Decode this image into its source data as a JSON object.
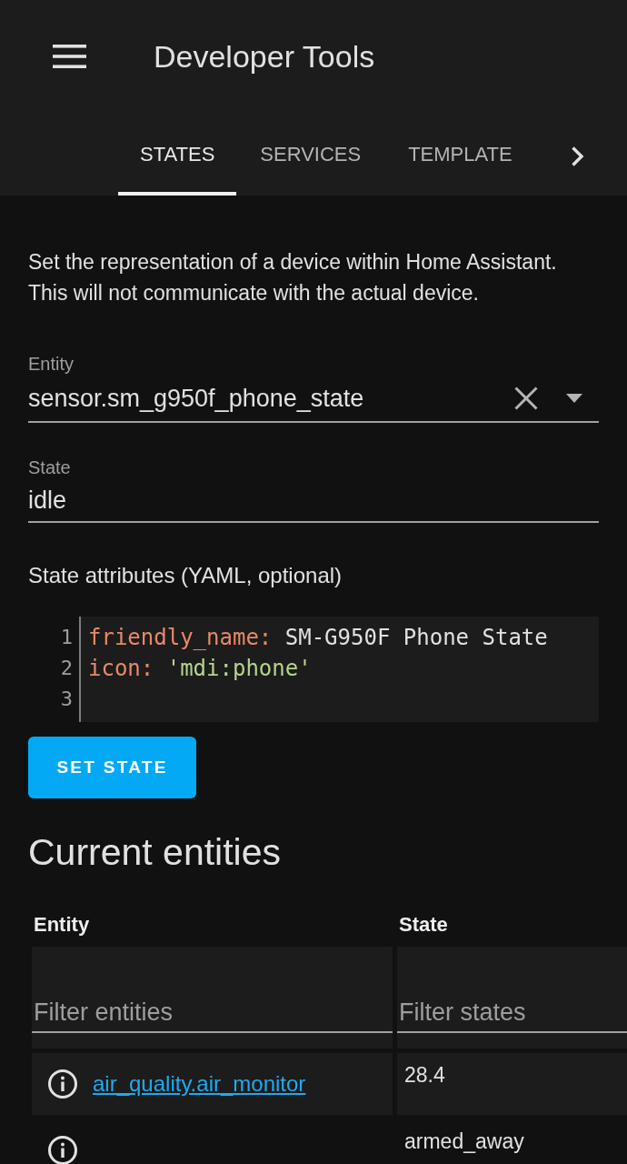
{
  "header": {
    "title": "Developer Tools"
  },
  "tabs": [
    {
      "label": "STATES",
      "selected": true
    },
    {
      "label": "SERVICES",
      "selected": false
    },
    {
      "label": "TEMPLATE",
      "selected": false
    }
  ],
  "description": "Set the representation of a device within Home Assistant. This will not communicate with the actual device.",
  "entity_field": {
    "label": "Entity",
    "value": "sensor.sm_g950f_phone_state"
  },
  "state_field": {
    "label": "State",
    "value": "idle"
  },
  "attributes": {
    "label": "State attributes (YAML, optional)",
    "lines": [
      {
        "number": "1",
        "tokens": [
          {
            "kind": "key",
            "text": "friendly_name:"
          },
          {
            "kind": "plain",
            "text": " SM-G950F Phone State"
          }
        ]
      },
      {
        "number": "2",
        "tokens": [
          {
            "kind": "key",
            "text": "icon:"
          },
          {
            "kind": "string",
            "text": " 'mdi:phone'"
          }
        ]
      },
      {
        "number": "3"
      }
    ]
  },
  "button": {
    "label": "SET STATE"
  },
  "entities": {
    "title": "Current entities",
    "columns": [
      "Entity",
      "State"
    ],
    "filters": [
      {
        "placeholder": "Filter entities"
      },
      {
        "placeholder": "Filter states"
      }
    ],
    "rows": [
      {
        "entity": "air_quality.air_monitor",
        "state": "28.4"
      },
      {
        "state": "armed_away"
      }
    ]
  }
}
